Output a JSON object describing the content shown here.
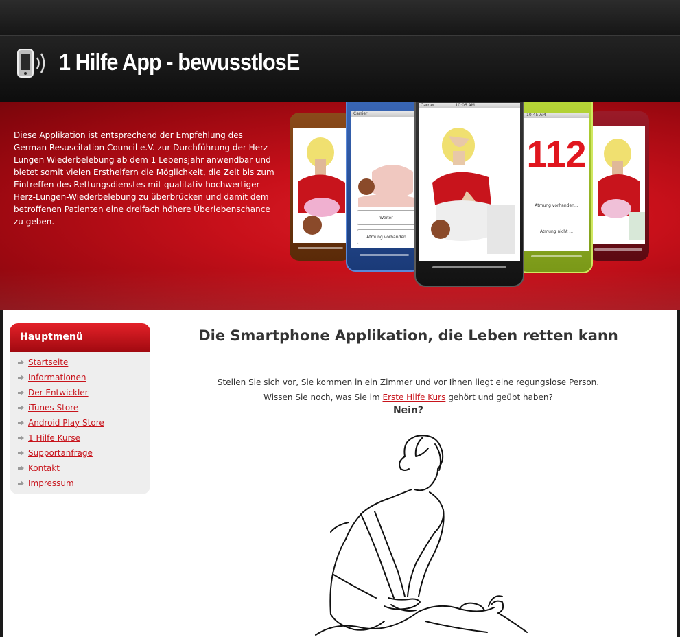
{
  "header": {
    "title": "1 Hilfe App - bewusstlosE",
    "logo_icon": "smartphone-signal-icon"
  },
  "banner": {
    "text": "Diese Applikation ist entsprechend der Empfehlung des German Resuscitation Council e.V. zur Durchführung der Herz Lungen Wiederbelebung ab dem 1 Lebensjahr anwendbar und bietet somit vielen Ersthelfern die Möglichkeit, die Zeit bis zum Eintreffen des Rettungsdienstes mit qualitativ hochwertiger Herz-Lungen-Wiederbelebung zu überbrücken und damit dem betroffenen Patienten eine dreifach höhere Überlebenschance zu geben.",
    "phones": {
      "center_status_carrier": "Carrier",
      "center_status_time": "10:06 AM",
      "blue_status_carrier": "Carrier",
      "blue_status_time": "10:45 AM",
      "blue_button_1": "Weiter",
      "blue_button_2": "Atmung vorhanden",
      "green_number": "112",
      "green_status_time": "10:45 AM",
      "green_button_1": "Atmung vorhanden...",
      "green_button_2": "Atmung nicht ..."
    }
  },
  "menu": {
    "heading": "Hauptmenü",
    "items": [
      {
        "label": "Startseite"
      },
      {
        "label": "Informationen"
      },
      {
        "label": "Der Entwickler"
      },
      {
        "label": "iTunes Store"
      },
      {
        "label": "Android Play Store"
      },
      {
        "label": "1 Hilfe Kurse"
      },
      {
        "label": "Supportanfrage"
      },
      {
        "label": "Kontakt"
      },
      {
        "label": "Impressum"
      }
    ]
  },
  "main": {
    "title": "Die Smartphone Applikation, die Leben retten kann",
    "intro_line1": "Stellen Sie sich vor, Sie kommen in ein Zimmer und vor Ihnen liegt eine regungslose Person.",
    "intro_line2_before": "Wissen Sie noch, was Sie im",
    "intro_link": "Erste Hilfe Kurs",
    "intro_line2_after": "gehört und geübt haben?",
    "question": "Nein?"
  },
  "colors": {
    "accent_red": "#c8141c",
    "banner_red": "#d0141d",
    "dark_header": "#161616"
  }
}
